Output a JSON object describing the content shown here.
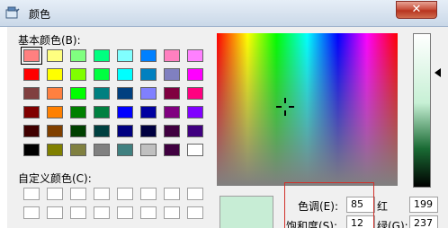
{
  "window": {
    "title": "颜色",
    "close_label": "✕"
  },
  "basic": {
    "label": "基本颜色(B):",
    "rows": [
      [
        "#ff8080",
        "#ffff80",
        "#80ff80",
        "#00ff80",
        "#80ffff",
        "#0080ff",
        "#ff80c0",
        "#ff80ff"
      ],
      [
        "#ff0000",
        "#ffff00",
        "#80ff00",
        "#00ff40",
        "#00ffff",
        "#0080c0",
        "#8080c0",
        "#ff00ff"
      ],
      [
        "#804040",
        "#ff8040",
        "#00ff00",
        "#008080",
        "#004080",
        "#8080ff",
        "#800040",
        "#ff0080"
      ],
      [
        "#800000",
        "#ff8000",
        "#008000",
        "#008040",
        "#0000ff",
        "#0000a0",
        "#800080",
        "#8000ff"
      ],
      [
        "#400000",
        "#804000",
        "#004000",
        "#004040",
        "#000080",
        "#000040",
        "#400040",
        "#400080"
      ],
      [
        "#000000",
        "#808000",
        "#808040",
        "#808080",
        "#408080",
        "#c0c0c0",
        "#400040",
        "#ffffff"
      ]
    ],
    "selected": "#ff8080"
  },
  "custom": {
    "label": "自定义颜色(C):",
    "rows": 2,
    "cols": 8
  },
  "preview_color": "#c7edd5",
  "fields": {
    "hue": {
      "label": "色调(E):",
      "value": "85"
    },
    "sat": {
      "label": "饱和度(S):",
      "value": "12"
    },
    "red": {
      "label": "红",
      "value": "199"
    },
    "green": {
      "label": "绿(G):",
      "value": "237"
    }
  }
}
